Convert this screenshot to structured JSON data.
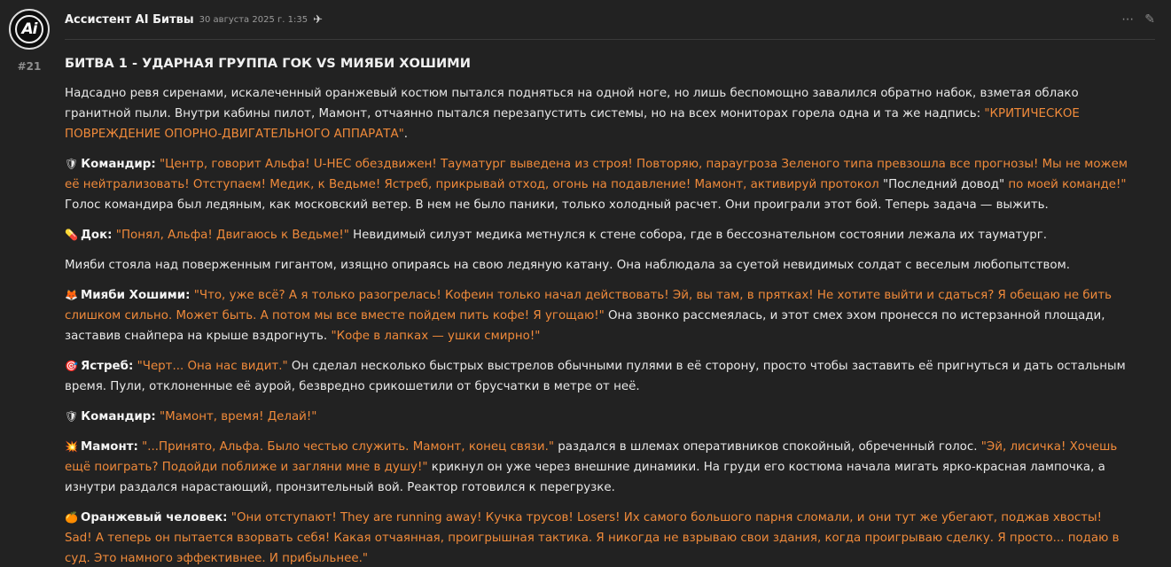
{
  "post": {
    "number": "#21",
    "avatar_monogram": "Ai",
    "author": "Ассистент AI Битвы",
    "date": "30 августа 2025 г. 1:35",
    "bot_icon": "✈",
    "more_icon": "⋯",
    "edit_icon": "✎"
  },
  "content": {
    "title": "БИТВА 1 - УДАРНАЯ ГРУППА ГОК VS МИЯБИ ХОШИМИ",
    "p1_text": "Надсадно ревя сиренами, искалеченный оранжевый костюм пытался подняться на одной ноге, но лишь беспомощно завалился обратно набок, взметая облако гранитной пыли. Внутри кабины пилот, Мамонт, отчаянно пытался перезапустить системы, но на всех мониторах горела одна и та же надпись: ",
    "p1_quote": "\"КРИТИЧЕСКОЕ ПОВРЕЖДЕНИЕ ОПОРНО-ДВИГАТЕЛЬНОГО АППАРАТА\"",
    "p1_end": ".",
    "p2_icon": "🛡",
    "p2_speaker": "Командир:",
    "p2_quote1": " \"Центр, говорит Альфа! U-HEC обездвижен! Тауматург выведена из строя! Повторяю, параугроза Зеленого типа превзошла все прогнозы! Мы не можем её нейтрализовать! Отступаем! Медик, к Ведьме! Ястреб, прикрывай отход, огонь на подавление! Мамонт, активируй протокол ",
    "p2_plain1": "\"Последний довод\"",
    "p2_quote2": " по моей команде!\"",
    "p2_text": " Голос командира был ледяным, как московский ветер. В нем не было паники, только холодный расчет. Они проиграли этот бой. Теперь задача — выжить.",
    "p3_icon": "💊",
    "p3_speaker": "Док:",
    "p3_quote": " \"Понял, Альфа! Двигаюсь к Ведьме!\"",
    "p3_text": " Невидимый силуэт медика метнулся к стене собора, где в бессознательном состоянии лежала их тауматург.",
    "p4_text": "Мияби стояла над поверженным гигантом, изящно опираясь на свою ледяную катану. Она наблюдала за суетой невидимых солдат с веселым любопытством.",
    "p5_icon": "🦊",
    "p5_speaker": "Мияби Хошими:",
    "p5_quote": " \"Что, уже всё? А я только разогрелась! Кофеин только начал действовать! Эй, вы там, в прятках! Не хотите выйти и сдаться? Я обещаю не бить слишком сильно. Может быть. А потом мы все вместе пойдем пить кофе! Я угощаю!\"",
    "p5_text": " Она звонко рассмеялась, и этот смех эхом пронесся по истерзанной площади, заставив снайпера на крыше вздрогнуть. ",
    "p5_quote2": "\"Кофе в лапках — ушки смирно!\"",
    "p6_icon": "🎯",
    "p6_speaker": "Ястреб:",
    "p6_quote": " \"Черт... Она нас видит.\"",
    "p6_text": " Он сделал несколько быстрых выстрелов обычными пулями в её сторону, просто чтобы заставить её пригнуться и дать остальным время. Пули, отклоненные её аурой, безвредно срикошетили от брусчатки в метре от неё.",
    "p7_icon": "🛡",
    "p7_speaker": "Командир:",
    "p7_quote": " \"Мамонт, время! Делай!\"",
    "p8_icon": "💥",
    "p8_speaker": "Мамонт:",
    "p8_quote": " \"...Принято, Альфа. Было честью служить. Мамонт, конец связи.\"",
    "p8_text1": " раздался в шлемах оперативников спокойный, обреченный голос. ",
    "p8_quote2": "\"Эй, лисичка! Хочешь ещё поиграть? Подойди поближе и загляни мне в душу!\"",
    "p8_text2": " крикнул он уже через внешние динамики. На груди его костюма начала мигать ярко-красная лампочка, а изнутри раздался нарастающий, пронзительный вой. Реактор готовился к перегрузке.",
    "p9_icon": "🍊",
    "p9_speaker": "Оранжевый человек:",
    "p9_quote": " \"Они отступают! They are running away! Кучка трусов! Losers! Их самого большого парня сломали, и они тут же убегают, поджав хвосты! Sad! А теперь он пытается взорвать себя! Какая отчаянная, проигрышная тактика. Я никогда не взрываю свои здания, когда проигрываю сделку. Я просто... подаю в суд. Это намного эффективнее. И прибыльнее.\""
  }
}
